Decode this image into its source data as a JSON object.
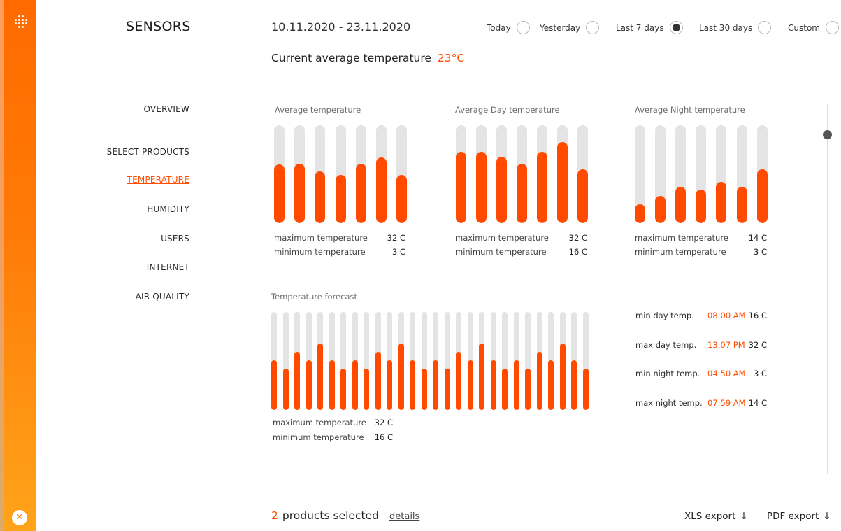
{
  "app": {
    "title": "SENSORS"
  },
  "header": {
    "date_range": "10.11.2020 - 23.11.2020",
    "ranges": [
      {
        "label": "Today",
        "selected": false
      },
      {
        "label": "Yesterday",
        "selected": false
      },
      {
        "label": "Last 7 days",
        "selected": true
      },
      {
        "label": "Last 30 days",
        "selected": false
      },
      {
        "label": "Custom",
        "selected": false
      }
    ],
    "current_label": "Current  average temperature",
    "current_value": "23°C"
  },
  "nav": {
    "items": [
      {
        "label": "OVERVIEW",
        "active": false
      },
      {
        "label": "SELECT PRODUCTS",
        "active": false
      },
      {
        "label": "TEMPERATURE",
        "active": true
      },
      {
        "label": "HUMIDITY",
        "active": false
      },
      {
        "label": "USERS",
        "active": false
      },
      {
        "label": "INTERNET",
        "active": false
      },
      {
        "label": "AIR QUALITY",
        "active": false
      }
    ]
  },
  "panels": {
    "average": {
      "title": "Average temperature",
      "max_label": "maximum temperature",
      "max_value": "32 C",
      "min_label": "minimum temperature",
      "min_value": "3 C"
    },
    "day": {
      "title": "Average Day temperature",
      "max_label": "maximum temperature",
      "max_value": "32 C",
      "min_label": "minimum temperature",
      "min_value": "16 C"
    },
    "night": {
      "title": "Average Night temperature",
      "max_label": "maximum temperature",
      "max_value": "14 C",
      "min_label": "minimum temperature",
      "min_value": "3 C"
    },
    "forecast": {
      "title": "Temperature forecast",
      "max_label": "maximum temperature",
      "max_value": "32 C",
      "min_label": "minimum temperature",
      "min_value": "16 C"
    }
  },
  "forecast_summary": [
    {
      "label": "min day temp.",
      "time": "08:00 AM",
      "value": "16 C"
    },
    {
      "label": "max day temp.",
      "time": "13:07 PM",
      "value": "32 C"
    },
    {
      "label": "min night temp.",
      "time": "04:50 AM",
      "value": "3 C"
    },
    {
      "label": "max night temp.",
      "time": "07:59 AM",
      "value": "14 C"
    }
  ],
  "footer": {
    "count": "2",
    "count_label": "products selected",
    "details": "details",
    "xls": "XLS export",
    "pdf": "PDF export",
    "arrow": "↓"
  },
  "colors": {
    "accent": "#ff4a00",
    "track": "#e4e4e4"
  },
  "icons": {
    "logo": "dot-grid-logo-icon",
    "close": "close-icon",
    "export": "arrow-down-icon"
  },
  "chart_data": [
    {
      "type": "bar",
      "title": "Average temperature",
      "values": [
        0.6,
        0.61,
        0.53,
        0.49,
        0.61,
        0.67,
        0.49
      ],
      "ylim": [
        0,
        1
      ]
    },
    {
      "type": "bar",
      "title": "Average Day temperature",
      "values": [
        0.73,
        0.73,
        0.68,
        0.61,
        0.73,
        0.83,
        0.55
      ],
      "ylim": [
        0,
        1
      ]
    },
    {
      "type": "bar",
      "title": "Average Night temperature",
      "values": [
        0.19,
        0.28,
        0.37,
        0.34,
        0.42,
        0.37,
        0.55
      ],
      "ylim": [
        0,
        1
      ]
    },
    {
      "type": "bar",
      "title": "Temperature forecast",
      "values": [
        0.51,
        0.42,
        0.59,
        0.51,
        0.68,
        0.51,
        0.42,
        0.51,
        0.42,
        0.59,
        0.51,
        0.68,
        0.51,
        0.42,
        0.51,
        0.42,
        0.59,
        0.51,
        0.68,
        0.51,
        0.42,
        0.51,
        0.42,
        0.59,
        0.51,
        0.68,
        0.51,
        0.42
      ],
      "ylim": [
        0,
        1
      ]
    }
  ]
}
